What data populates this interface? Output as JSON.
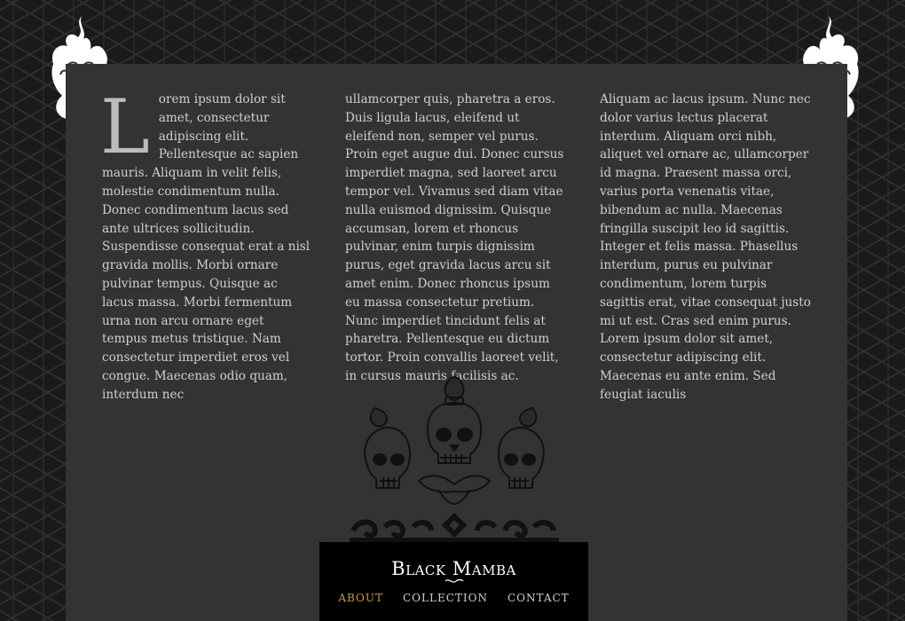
{
  "content": {
    "dropcap": "L",
    "column1": "orem ipsum dolor sit amet, consectetur adipiscing elit. Pellentesque ac sapien mauris. Aliquam in velit felis, molestie condimentum nulla. Donec condimentum lacus sed ante ultrices sollicitudin. Suspendisse consequat erat a nisl gravida mollis. Morbi ornare pulvinar tempus. Quisque ac lacus massa. Morbi fermentum urna non arcu ornare eget tempus metus tristique. Nam consectetur imperdiet eros vel congue. Maecenas odio quam, interdum nec",
    "column2": "ullamcorper quis, pharetra a eros. Duis ligula lacus, eleifend ut eleifend non, semper vel purus. Proin eget augue dui. Donec cursus imperdiet magna, sed laoreet arcu tempor vel. Vivamus sed diam vitae nulla euismod dignissim. Quisque accumsan, lorem et rhoncus pulvinar, enim turpis dignissim purus, eget gravida lacus arcu sit amet enim. Donec rhoncus ipsum eu massa consectetur pretium. Nunc imperdiet tincidunt felis at pharetra. Pellentesque eu dictum tortor. Proin convallis laoreet velit, in cursus mauris facilisis ac.",
    "column3": "Aliquam ac lacus ipsum. Nunc nec dolor varius lectus placerat interdum. Aliquam orci nibh, aliquet vel ornare ac, ullamcorper id magna. Praesent massa orci, varius porta venenatis vitae, bibendum ac nulla. Maecenas fringilla suscipit leo id sagittis. Integer et felis massa. Phasellus interdum, purus eu pulvinar condimentum, lorem turpis sagittis erat, vitae consequat justo mi ut est. Cras sed enim purus. Lorem ipsum dolor sit amet, consectetur adipiscing elit. Maecenas eu ante enim. Sed feugiat iaculis"
  },
  "brand": {
    "logo_text": "Black Mamba"
  },
  "nav": {
    "items": [
      {
        "label": "ABOUT"
      },
      {
        "label": "COLLECTION"
      },
      {
        "label": "CONTACT"
      }
    ]
  },
  "decor": {
    "left_corner_icon": "flame-icon",
    "right_corner_icon": "flame-icon",
    "emblem_icon": "three-skulls-crown-icon"
  },
  "colors": {
    "background": "#1a1a1a",
    "panel": "#333333",
    "footer": "#000000",
    "text": "#cfcfcf",
    "nav_active": "#c9a227"
  }
}
